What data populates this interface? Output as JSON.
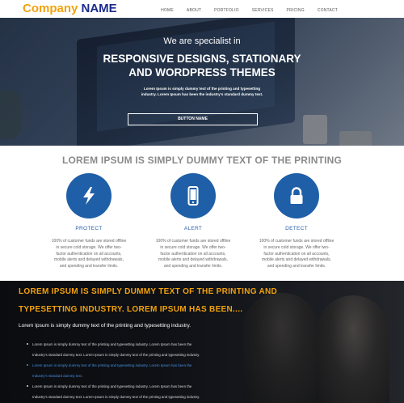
{
  "header": {
    "logo_part1": "Company",
    "logo_part2": "NAME",
    "nav": [
      "HOME",
      "ABOUT",
      "PORTFOLIO",
      "SERVICES",
      "PRICING",
      "CONTACT"
    ]
  },
  "hero": {
    "kicker": "We are specialist in",
    "title_line1": "RESPONSIVE DESIGNS, STATIONARY",
    "title_line2": "AND WORDPRESS THEMES",
    "subtitle_line1": "Lorem Ipsum is simply dummy text of the printing and typesetting",
    "subtitle_line2": "industry. Lorem Ipsum has been the industry's standard dummy text.",
    "button_label": "BUTTON NAME"
  },
  "features": {
    "heading": "LOREM IPSUM IS SIMPLY DUMMY TEXT OF THE PRINTING",
    "items": [
      {
        "icon": "lightning-icon",
        "title": "PROTECT",
        "text_lines": [
          "100% of customer funds are stored offline",
          "in secure cold storage. We offer two-",
          "factor authentication on all accounts,",
          "mobile alerts and delayed withdrawals,",
          "and spending and transfer limits."
        ]
      },
      {
        "icon": "mobile-phone-icon",
        "title": "ALERT",
        "text_lines": [
          "100% of customer funds are stored offline",
          "in secure cold storage. We offer two-",
          "factor authentication on all accounts,",
          "mobile alerts and delayed withdrawals,",
          "and spending and transfer limits."
        ]
      },
      {
        "icon": "padlock-icon",
        "title": "DETECT",
        "text_lines": [
          "100% of customer funds are stored offline",
          "in secure cold storage. We offer two-",
          "factor authentication on all accounts,",
          "mobile alerts and delayed withdrawals,",
          "and spending and transfer limits."
        ]
      }
    ],
    "icon_color": "#1f5fa7",
    "title_color": "#2a5faa"
  },
  "dark_section": {
    "heading_line1": "LOREM IPSUM IS SIMPLY DUMMY TEXT OF THE PRINTING AND",
    "heading_line2": "TYPESETTING INDUSTRY. LOREM IPSUM HAS BEEN....",
    "heading_color": "#f2a20c",
    "subheading": "Lorem Ipsum is simply dummy text of the printing and typesetting industry.",
    "list": [
      {
        "text": "Lorem Ipsum is simply dummy text of the printing and typesetting industry. Lorem Ipsum has been the",
        "style": "normal"
      },
      {
        "text": "Industry's standard dummy text. Lorem Ipsum is simply dummy text of the printing and typesetting industry.",
        "style": "nodot"
      },
      {
        "text": "Lorem Ipsum is simply dummy text of the printing and typesetting industry. Lorem Ipsum has been the",
        "style": "blue"
      },
      {
        "text": "Industry's standard dummy text.",
        "style": "blue-nodot"
      },
      {
        "text": "Lorem Ipsum is simply dummy text of the printing and typesetting industry. Lorem Ipsum has been the",
        "style": "normal"
      },
      {
        "text": "Industry's standard dummy text. Lorem Ipsum is simply dummy text of the printing and typesetting industry.",
        "style": "nodot"
      }
    ]
  }
}
